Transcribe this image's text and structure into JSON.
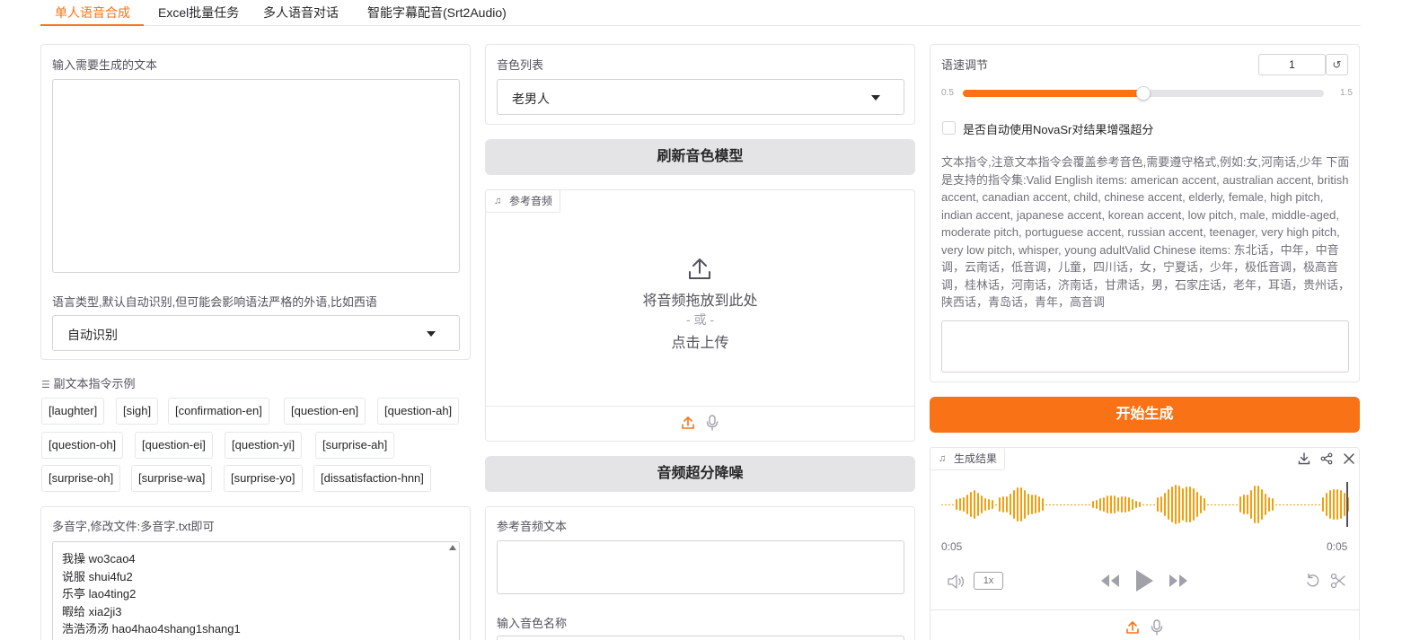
{
  "tabs": [
    {
      "label": "单人语音合成",
      "active": true
    },
    {
      "label": "Excel批量任务",
      "active": false
    },
    {
      "label": "多人语音对话",
      "active": false
    },
    {
      "label": "智能字幕配音(Srt2Audio)",
      "active": false
    }
  ],
  "left": {
    "text_input_label": "输入需要生成的文本",
    "text_input_value": "",
    "language_label": "语言类型,默认自动识别,但可能会影响语法严格的外语,比如西语",
    "language_value": "自动识别",
    "chips_title": "副文本指令示例",
    "chips": [
      "[laughter]",
      "[sigh]",
      "[confirmation-en]",
      "[question-en]",
      "[question-ah]",
      "[question-oh]",
      "[question-ei]",
      "[question-yi]",
      "[surprise-ah]",
      "[surprise-oh]",
      "[surprise-wa]",
      "[surprise-yo]",
      "[dissatisfaction-hnn]"
    ],
    "polyphone_label": "多音字,修改文件:多音字.txt即可",
    "polyphone_lines": [
      "我操 wo3cao4",
      "说服 shui4fu2",
      "乐亭 lao4ting2",
      "暇给 xia2ji3",
      "浩浩汤汤 hao4hao4shang1shang1"
    ]
  },
  "middle": {
    "voice_list_label": "音色列表",
    "voice_value": "老男人",
    "refresh_button": "刷新音色模型",
    "ref_audio_tag": "参考音频",
    "drop_text": "将音频拖放到此处",
    "or_text": "- 或 -",
    "click_upload": "点击上传",
    "denoise_button": "音频超分降噪",
    "ref_text_label": "参考音频文本",
    "voice_name_label": "输入音色名称"
  },
  "right": {
    "speed_label": "语速调节",
    "speed_value": "1",
    "speed_min": "0.5",
    "speed_max": "1.5",
    "speed_fraction": 0.5,
    "novasr_label": "是否自动使用NovaSr对结果增强超分",
    "instruction_note": "文本指令,注意文本指令会覆盖参考音色,需要遵守格式,例如:女,河南话,少年 下面是支持的指令集:Valid English items: american accent, australian accent, british accent, canadian accent, child, chinese accent, elderly, female, high pitch, indian accent, japanese accent, korean accent, low pitch, male, middle-aged, moderate pitch, portuguese accent, russian accent, teenager, very high pitch, very low pitch, whisper, young adultValid Chinese items: 东北话，中年，中音调，云南话，低音调，儿童，四川话，女，宁夏话，少年，极低音调，极高音调，桂林话，河南话，济南话，甘肃话，男，石家庄话，老年，耳语，贵州话，陕西话，青岛话，青年，高音调",
    "generate_button": "开始生成",
    "result_tag": "生成结果",
    "time_current": "0:05",
    "time_total": "0:05",
    "playback_rate": "1x"
  },
  "colors": {
    "accent": "#f97316",
    "waveform": "#f59e0b"
  }
}
